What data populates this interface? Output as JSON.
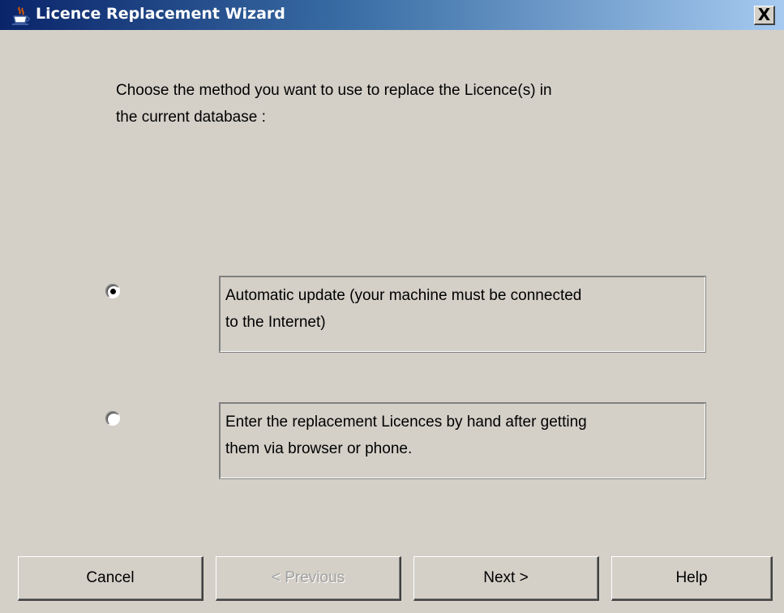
{
  "window": {
    "title": "Licence Replacement Wizard",
    "close_label": "X"
  },
  "prompt": {
    "line1": "Choose the method you want to use to replace the Licence(s) in",
    "line2": "the current database :"
  },
  "options": [
    {
      "line1": "Automatic update (your machine must be connected",
      "line2": "to the Internet)",
      "selected": true
    },
    {
      "line1": "Enter the replacement Licences by hand after getting",
      "line2": "them via browser or phone.",
      "selected": false
    }
  ],
  "buttons": {
    "cancel": "Cancel",
    "previous": "< Previous",
    "previous_enabled": false,
    "next": "Next >",
    "help": "Help"
  },
  "colors": {
    "window_bg": "#d4d0c8",
    "title_start": "#0a246a",
    "title_end": "#a6caf0",
    "title_text": "#ffffff",
    "disabled_text": "#a0a0a0"
  }
}
